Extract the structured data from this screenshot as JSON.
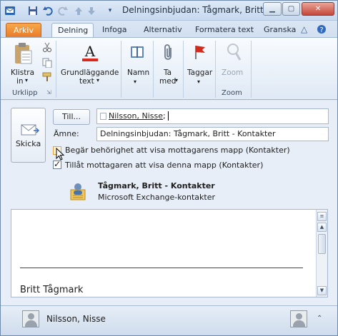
{
  "window": {
    "title": "Delningsinbjudan: Tågmark, Britt..."
  },
  "quick_access": {
    "icons": [
      "outlook-icon",
      "save-icon",
      "undo-icon",
      "redo-icon",
      "arrow-up-icon",
      "arrow-down-icon",
      "customize-icon"
    ]
  },
  "tabs": [
    {
      "label": "Arkiv"
    },
    {
      "label": "Delning"
    },
    {
      "label": "Infoga"
    },
    {
      "label": "Alternativ"
    },
    {
      "label": "Formatera text"
    },
    {
      "label": "Granska"
    }
  ],
  "ribbon": {
    "clipboard": {
      "paste_line1": "Klistra",
      "paste_line2": "in",
      "group": "Urklipp"
    },
    "basic_text": {
      "line1": "Grundläggande",
      "line2": "text"
    },
    "names": {
      "label": "Namn"
    },
    "include": {
      "line1": "Ta",
      "line2": "med"
    },
    "tags": {
      "label": "Taggar"
    },
    "zoom": {
      "label": "Zoom",
      "group": "Zoom"
    }
  },
  "form": {
    "send_label": "Skicka",
    "to_button": "Till...",
    "to_value": "Nilsson,  Nisse",
    "to_suffix": ";",
    "subject_label": "Ämne:",
    "subject_value": "Delningsinbjudan: Tågmark, Britt - Kontakter",
    "request_permission": "Begär behörighet att visa mottagarens mapp (Kontakter)",
    "allow_view": "Tillåt mottagaren att visa denna mapp (Kontakter)",
    "shared_folder_title": "Tågmark, Britt - Kontakter",
    "shared_folder_sub": "Microsoft Exchange-kontakter"
  },
  "body": {
    "signature_name": "Britt Tågmark"
  },
  "people_pane": {
    "name": "Nilsson,  Nisse"
  },
  "colors": {
    "file_tab": "#e9782a",
    "accent": "#2c4d7a"
  }
}
